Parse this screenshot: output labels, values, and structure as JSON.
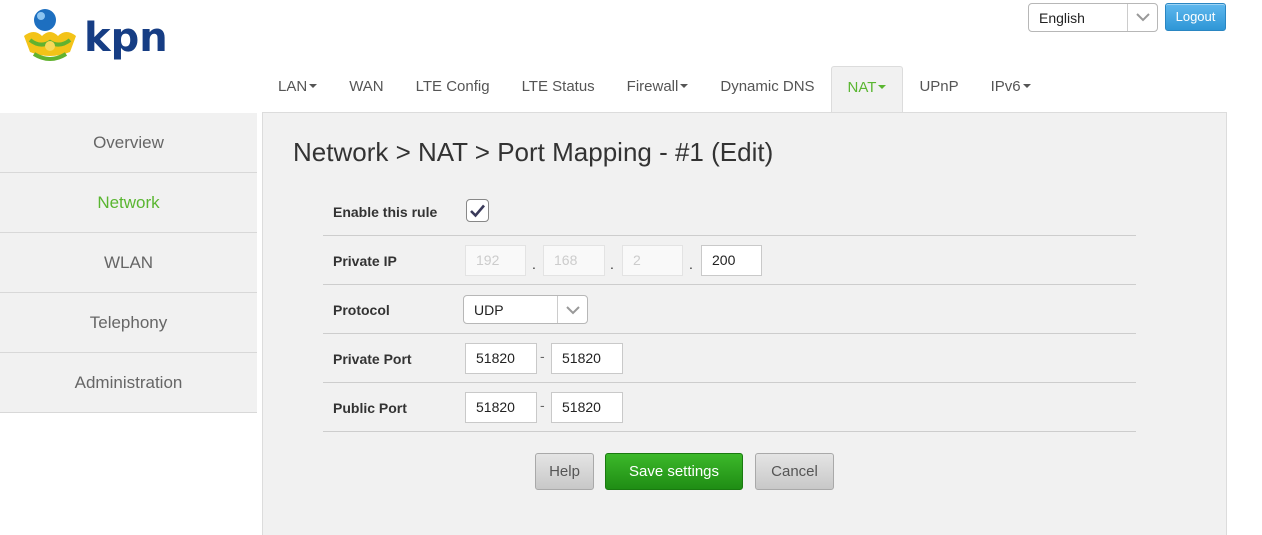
{
  "brand": {
    "name": "kpn"
  },
  "header": {
    "language": {
      "selected": "English"
    },
    "logout_label": "Logout"
  },
  "nav": {
    "tabs": [
      {
        "label": "LAN",
        "dropdown": true
      },
      {
        "label": "WAN",
        "dropdown": false
      },
      {
        "label": "LTE Config",
        "dropdown": false
      },
      {
        "label": "LTE Status",
        "dropdown": false
      },
      {
        "label": "Firewall",
        "dropdown": true
      },
      {
        "label": "Dynamic DNS",
        "dropdown": false
      },
      {
        "label": "NAT",
        "dropdown": true,
        "active": true
      },
      {
        "label": "UPnP",
        "dropdown": false
      },
      {
        "label": "IPv6",
        "dropdown": true
      }
    ]
  },
  "sidebar": {
    "items": [
      {
        "label": "Overview"
      },
      {
        "label": "Network",
        "active": true
      },
      {
        "label": "WLAN"
      },
      {
        "label": "Telephony"
      },
      {
        "label": "Administration"
      }
    ]
  },
  "page": {
    "title": "Network > NAT > Port Mapping - #1 (Edit)"
  },
  "form": {
    "enable_rule": {
      "label": "Enable this rule",
      "checked": true
    },
    "private_ip": {
      "label": "Private IP",
      "octets": [
        "192",
        "168",
        "2",
        "200"
      ],
      "separator": "."
    },
    "protocol": {
      "label": "Protocol",
      "value": "UDP"
    },
    "private_port": {
      "label": "Private Port",
      "from": "51820",
      "to": "51820",
      "separator": "-"
    },
    "public_port": {
      "label": "Public Port",
      "from": "51820",
      "to": "51820",
      "separator": "-"
    }
  },
  "actions": {
    "help_label": "Help",
    "save_label": "Save settings",
    "cancel_label": "Cancel"
  },
  "colors": {
    "brand_blue": "#163d84",
    "accent_green": "#5ab631",
    "save_green": "#2aa21c",
    "logout_blue": "#3aa3e0"
  }
}
